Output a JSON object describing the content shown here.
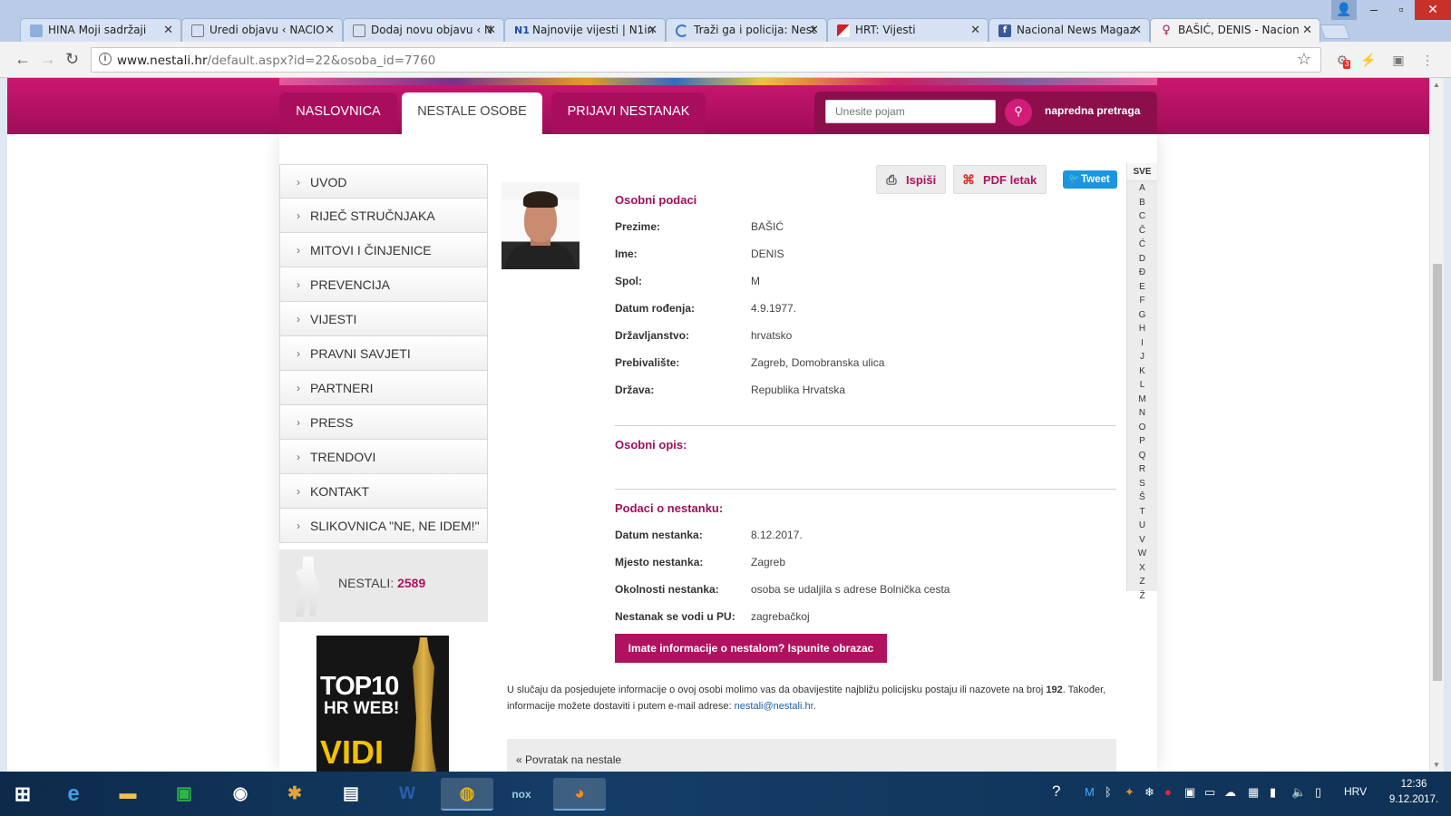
{
  "browser": {
    "tabs": [
      {
        "title": "HINA Moji sadržaji",
        "icon": "document-icon"
      },
      {
        "title": "Uredi objavu ‹ NACIO",
        "icon": "page-icon"
      },
      {
        "title": "Dodaj novu objavu ‹ N",
        "icon": "page-icon"
      },
      {
        "title": "Najnovije vijesti | N1in",
        "icon": "n1-icon"
      },
      {
        "title": "Traži ga i policija: Nest",
        "icon": "loading-icon"
      },
      {
        "title": "HRT: Vijesti",
        "icon": "hrt-icon"
      },
      {
        "title": "Nacional News Magaz",
        "icon": "facebook-icon"
      },
      {
        "title": "BAŠIĆ, DENIS - Nacion",
        "icon": "nestali-icon",
        "active": true
      }
    ],
    "url_host": "www.nestali.hr",
    "url_rest": "/default.aspx?id=22&osoba_id=7760",
    "notification_count": "3"
  },
  "site": {
    "nav": [
      "NASLOVNICA",
      "NESTALE OSOBE",
      "PRIJAVI NESTANAK"
    ],
    "active_nav": "NESTALE OSOBE",
    "search_placeholder": "Unesite pojam",
    "advanced_search": "napredna pretraga",
    "accent_color": "#b0125f"
  },
  "sidebar": {
    "items": [
      "UVOD",
      "RIJEČ STRUČNJAKA",
      "MITOVI I ČINJENICE",
      "PREVENCIJA",
      "VIJESTI",
      "PRAVNI SAVJETI",
      "PARTNERI",
      "PRESS",
      "TRENDOVI",
      "KONTAKT",
      "SLIKOVNICA \"NE, NE IDEM!\""
    ],
    "counter_label": "NESTALI:",
    "counter_value": "2589",
    "badge_line1": "TOP10",
    "badge_line2": "HR WEB!",
    "badge_line3": "VIDI"
  },
  "actions": {
    "print": "Ispiši",
    "pdf": "PDF letak",
    "tweet": "Tweet"
  },
  "person": {
    "section_personal": "Osobni podaci",
    "fields": [
      {
        "label": "Prezime:",
        "value": "BAŠIĆ"
      },
      {
        "label": "Ime:",
        "value": "DENIS"
      },
      {
        "label": "Spol:",
        "value": "M"
      },
      {
        "label": "Datum rođenja:",
        "value": "4.9.1977."
      },
      {
        "label": "Državljanstvo:",
        "value": "hrvatsko"
      },
      {
        "label": "Prebivalište:",
        "value": "Zagreb, Domobranska ulica"
      },
      {
        "label": "Država:",
        "value": "Republika Hrvatska"
      }
    ],
    "section_description": "Osobni opis:",
    "section_missing": "Podaci o nestanku:",
    "missing_fields": [
      {
        "label": "Datum nestanka:",
        "value": "8.12.2017."
      },
      {
        "label": "Mjesto nestanka:",
        "value": "Zagreb"
      },
      {
        "label": "Okolnosti nestanka:",
        "value": "osoba se udaljila s adrese Bolnička cesta"
      },
      {
        "label": "Nestanak se vodi u PU:",
        "value": "zagrebačkoj"
      }
    ],
    "cta": "Imate informacije o nestalom? Ispunite obrazac",
    "note_part1": "U slučaju da posjedujete informacije o ovoj osobi molimo vas da obavijestite najbližu policijsku postaju ili nazovete na broj ",
    "note_phone": "192",
    "note_part2": ". Također, informacije možete dostaviti i putem e-mail adrese: ",
    "note_email": "nestali@nestali.hr",
    "note_end": ".",
    "back_link": "« Povratak na nestale"
  },
  "alphabet": {
    "all": "SVE",
    "letters": [
      "A",
      "B",
      "C",
      "Č",
      "Ć",
      "D",
      "Đ",
      "E",
      "F",
      "G",
      "H",
      "I",
      "J",
      "K",
      "L",
      "M",
      "N",
      "O",
      "P",
      "Q",
      "R",
      "S",
      "Š",
      "T",
      "U",
      "V",
      "W",
      "X",
      "Z",
      "Ž"
    ]
  },
  "taskbar": {
    "language": "HRV",
    "time": "12:36",
    "date": "9.12.2017."
  }
}
